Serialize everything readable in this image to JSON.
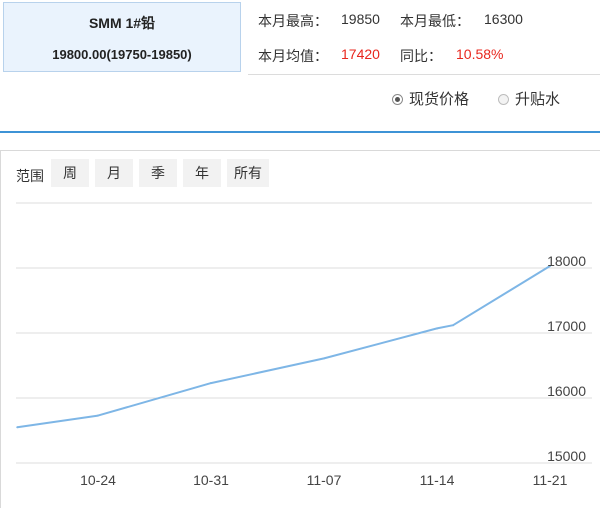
{
  "product": {
    "name": "SMM 1#铅",
    "price": "19800.00(19750-19850)"
  },
  "stats": {
    "month_high_label": "本月最高：",
    "month_high_value": "19850",
    "month_low_label": "本月最低：",
    "month_low_value": "16300",
    "month_avg_label": "本月均值：",
    "month_avg_value": "17420",
    "yoy_label": "同比：",
    "yoy_value": "10.58%"
  },
  "price_type": {
    "options": [
      "现货价格",
      "升贴水"
    ],
    "selected": "现货价格"
  },
  "range": {
    "label": "范围",
    "buttons": [
      "周",
      "月",
      "季",
      "年",
      "所有"
    ]
  },
  "colors": {
    "line": "#7eb6e6",
    "accent": "#3d93d6",
    "negative_red": "#e8271e"
  },
  "chart_data": {
    "type": "line",
    "title": "",
    "xlabel": "",
    "ylabel": "",
    "x_ticks": [
      "10-24",
      "10-31",
      "11-07",
      "11-14",
      "11-21"
    ],
    "y_ticks": [
      "15000",
      "16000",
      "17000",
      "18000"
    ],
    "ylim": [
      14900,
      18800
    ],
    "grid": true,
    "legend": "none",
    "series": [
      {
        "x": [
          "10-19",
          "10-24",
          "10-31",
          "11-07",
          "11-14",
          "11-15",
          "11-21"
        ],
        "values": [
          15550,
          15730,
          16230,
          16610,
          17070,
          17120,
          18030
        ]
      }
    ]
  }
}
